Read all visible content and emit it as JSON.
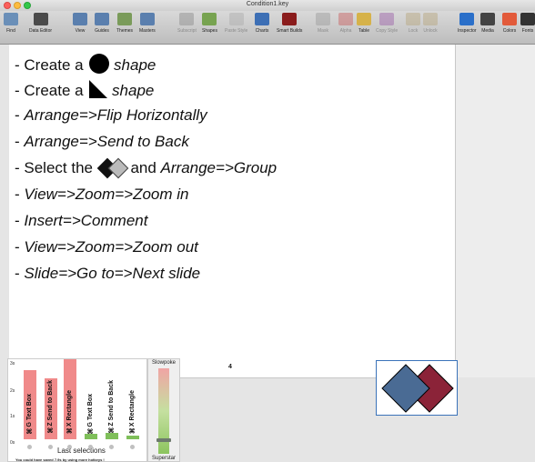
{
  "window": {
    "title": "Condition1.key"
  },
  "toolbar": {
    "items": [
      {
        "label": "Find",
        "icon": "magnifier-icon",
        "color": "#6a8fb8"
      },
      {
        "label": "Data Editor",
        "icon": "data-editor-icon",
        "color": "#4b4b4b"
      },
      {
        "label": "View",
        "icon": "view-icon",
        "color": "#5a7fae"
      },
      {
        "label": "Guides",
        "icon": "guides-icon",
        "color": "#5a7fae"
      },
      {
        "label": "Themes",
        "icon": "themes-icon",
        "color": "#7a9b5a"
      },
      {
        "label": "Masters",
        "icon": "masters-icon",
        "color": "#5a7fae"
      },
      {
        "label": "Subscript",
        "icon": "subscript-icon",
        "color": "#8a8a8a",
        "dim": true
      },
      {
        "label": "Shapes",
        "icon": "shapes-icon",
        "color": "#77a350"
      },
      {
        "label": "Paste Style",
        "icon": "paste-style-icon",
        "color": "#aaaaaa",
        "dim": true
      },
      {
        "label": "Charts",
        "icon": "charts-icon",
        "color": "#3d6fb5"
      },
      {
        "label": "Smart Builds",
        "icon": "smart-builds-icon",
        "color": "#8a1c1c"
      },
      {
        "label": "Mask",
        "icon": "mask-icon",
        "color": "#9a9a9a",
        "dim": true
      },
      {
        "label": "Alpha",
        "icon": "alpha-icon",
        "color": "#c85a5a",
        "dim": true
      },
      {
        "label": "Table",
        "icon": "table-icon",
        "color": "#d6b24a"
      },
      {
        "label": "Copy Style",
        "icon": "copy-style-icon",
        "color": "#9a5aa6",
        "dim": true
      },
      {
        "label": "Lock",
        "icon": "lock-icon",
        "color": "#b5a37a",
        "dim": true
      },
      {
        "label": "Unlock",
        "icon": "unlock-icon",
        "color": "#b5a37a",
        "dim": true
      },
      {
        "label": "Inspector",
        "icon": "inspector-icon",
        "color": "#2a6fc9"
      },
      {
        "label": "Media",
        "icon": "media-icon",
        "color": "#444444"
      },
      {
        "label": "Colors",
        "icon": "colors-icon",
        "color": "#e25a3a"
      },
      {
        "label": "Fonts",
        "icon": "fonts-icon",
        "color": "#333333"
      }
    ]
  },
  "slide": {
    "lines": [
      {
        "parts": [
          {
            "t": "- Create a ",
            "i": false
          },
          {
            "shape": "circle"
          },
          {
            "t": " shape",
            "i": true
          }
        ]
      },
      {
        "parts": [
          {
            "t": "- Create a ",
            "i": false
          },
          {
            "shape": "triangle"
          },
          {
            "t": " shape",
            "i": true
          }
        ]
      },
      {
        "parts": [
          {
            "t": "- ",
            "i": false
          },
          {
            "t": "Arrange=>Flip Horizontally",
            "i": true
          }
        ]
      },
      {
        "parts": [
          {
            "t": "- ",
            "i": false
          },
          {
            "t": "Arrange=>Send to Back",
            "i": true
          }
        ]
      },
      {
        "parts": [
          {
            "t": "- Select the ",
            "i": false
          },
          {
            "shape": "diamonds"
          },
          {
            "t": " and ",
            "i": false
          },
          {
            "t": "Arrange=>Group",
            "i": true
          }
        ]
      },
      {
        "parts": [
          {
            "t": "- ",
            "i": false
          },
          {
            "t": "View=>Zoom=>Zoom in",
            "i": true
          }
        ]
      },
      {
        "parts": [
          {
            "t": "- ",
            "i": false
          },
          {
            "t": "Insert=>Comment",
            "i": true
          }
        ]
      },
      {
        "parts": [
          {
            "t": "- ",
            "i": false
          },
          {
            "t": "View=>Zoom=>Zoom out",
            "i": true
          }
        ]
      },
      {
        "parts": [
          {
            "t": "- ",
            "i": false
          },
          {
            "t": "Slide=>Go to=>Next slide",
            "i": true
          }
        ]
      }
    ],
    "page_number": "4",
    "thumbnail_colors": {
      "blue": "#4a6b94",
      "red": "#8b2338"
    }
  },
  "stats": {
    "y_ticks": [
      "3s",
      "2s",
      "1s",
      "0s"
    ],
    "bars": [
      {
        "label": "⌘G Text Box",
        "color": "#f08a8a",
        "seconds": 2.6
      },
      {
        "label": "⌘Z Send to Back",
        "color": "#f08a8a",
        "seconds": 2.3
      },
      {
        "label": "⌘X Rectangle",
        "color": "#f08a8a",
        "seconds": 3.0
      },
      {
        "label": "⌘G Text Box",
        "color": "#7fbf5a",
        "seconds": 0.2
      },
      {
        "label": "⌘Z Send to Back",
        "color": "#7fbf5a",
        "seconds": 0.25
      },
      {
        "label": "⌘X Rectangle",
        "color": "#7fbf5a",
        "seconds": 0.15
      }
    ],
    "caption": "Last selections",
    "hint": "You could have saved 7.9s by using more hotkeys !"
  },
  "speed": {
    "top_label": "Slowpoke",
    "bottom_label": "Superstar",
    "level": 0.18
  }
}
